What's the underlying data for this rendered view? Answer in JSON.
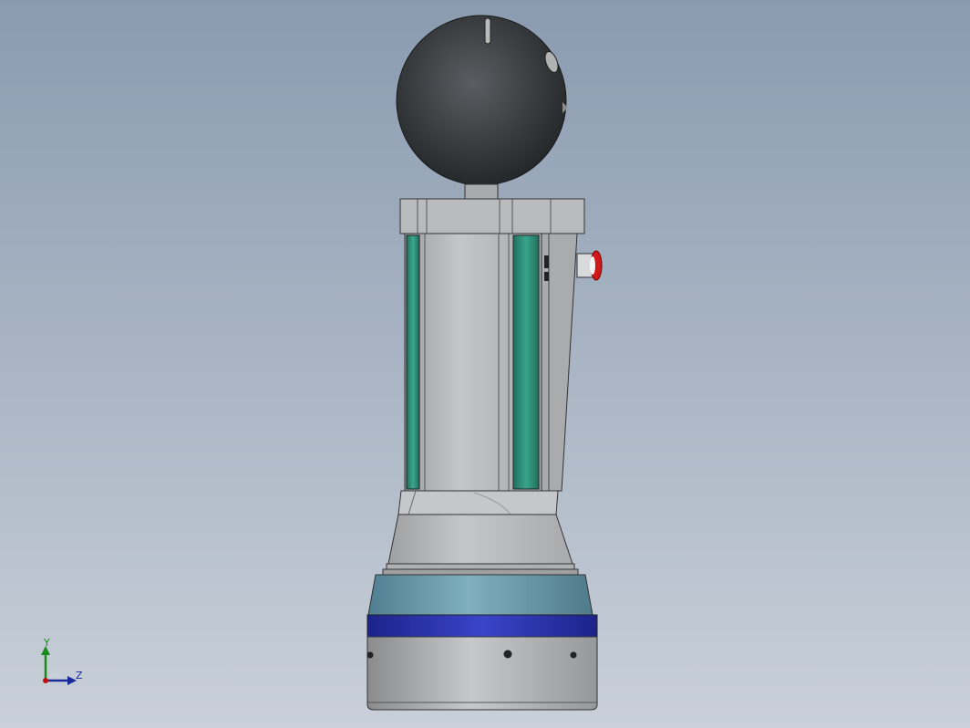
{
  "viewport": {
    "background_top": "#8a9bb0",
    "background_bottom": "#c9d0d9"
  },
  "model": {
    "colors": {
      "sphere": "#3a3d40",
      "body_gray": "#b7b9bb",
      "teal_panel": "#2f8f7a",
      "base_steel": "#6f9fb0",
      "base_band": "#2a33a8",
      "button_red": "#d01818"
    }
  },
  "triad": {
    "y_label": "Y",
    "z_label": "Z",
    "y_color": "#1a8a1a",
    "z_color": "#1a2a9a",
    "origin_color": "#c01010"
  }
}
